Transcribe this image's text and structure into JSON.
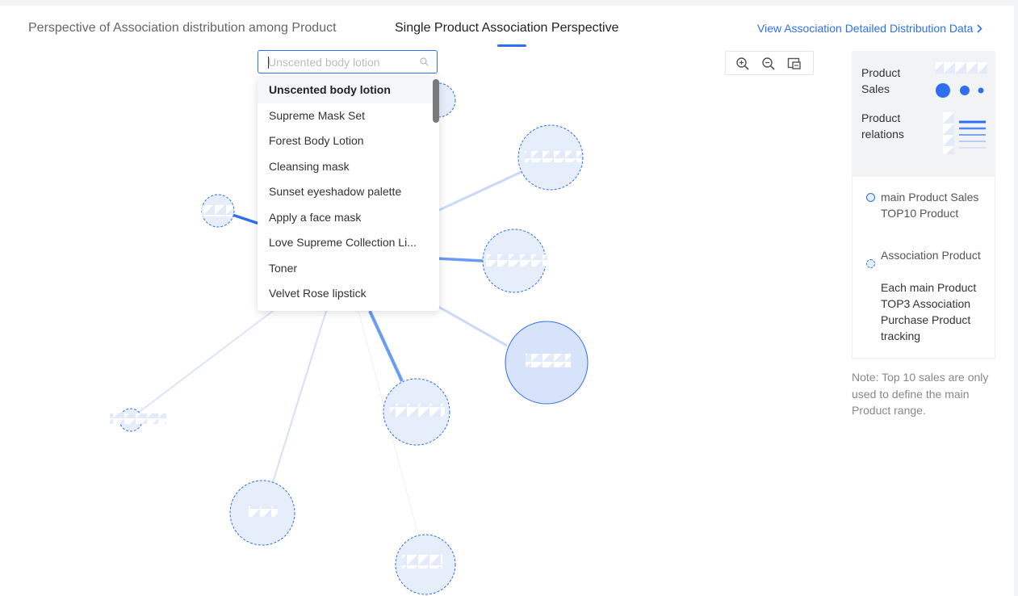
{
  "tabs": [
    {
      "label": "Perspective of Association distribution among Product"
    },
    {
      "label": "Single Product Association Perspective"
    }
  ],
  "detail_link": {
    "label": "View Association Detailed Distribution Data"
  },
  "search": {
    "placeholder": "Unscented body lotion",
    "value": ""
  },
  "dropdown": {
    "items": [
      {
        "label": "Unscented body lotion"
      },
      {
        "label": "Supreme Mask Set"
      },
      {
        "label": "Forest Body Lotion"
      },
      {
        "label": "Cleansing mask"
      },
      {
        "label": "Sunset eyeshadow palette"
      },
      {
        "label": "Apply a face mask"
      },
      {
        "label": "Love Supreme Collection Li..."
      },
      {
        "label": "Toner"
      },
      {
        "label": "Velvet Rose lipstick"
      }
    ]
  },
  "toolbar": {
    "zoom_in": "zoom-in-icon",
    "zoom_out": "zoom-out-icon",
    "fit": "fit-view-icon"
  },
  "legend": {
    "sales_label": "Product Sales",
    "relations_label": "Product relations",
    "main_product": "main Product Sales TOP10 Product",
    "assoc_title": "Association Product",
    "assoc_desc": "Each main Product TOP3 Association Purchase Product tracking"
  },
  "note": "Note: Top 10 sales are only used to define the main Product range.",
  "colors": {
    "accent": "#2e6ff2",
    "node_fill": "#e6eefc",
    "main_node_fill": "#d6e3fb",
    "edge": "#c5d6f6"
  }
}
